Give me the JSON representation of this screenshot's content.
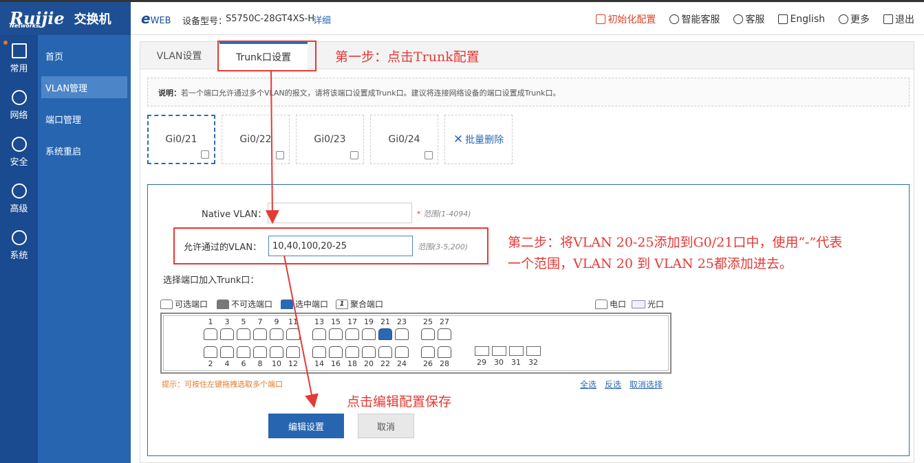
{
  "brand": {
    "logo": "Ruijie",
    "logo_sub": "Networks",
    "title": "交换机"
  },
  "header": {
    "eweb": "e",
    "eweb_suffix": "WEB",
    "model_label": "设备型号：",
    "model_value": "S5750C-28GT4XS-H",
    "detail": "详细",
    "actions": [
      "初始化配置",
      "智能客服",
      "客服",
      "English",
      "更多",
      "退出"
    ]
  },
  "nav": {
    "primary": [
      "常用",
      "网络",
      "安全",
      "高级",
      "系统"
    ],
    "secondary": [
      "首页",
      "VLAN管理",
      "端口管理",
      "系统重启"
    ]
  },
  "tabs": [
    "VLAN设置",
    "Trunk口设置"
  ],
  "note": {
    "label": "说明：",
    "text": "若一个端口允许通过多个VLAN的报文，请将该端口设置成Trunk口。建议将连接网络设备的端口设置成Trunk口。"
  },
  "port_cards": [
    "Gi0/21",
    "Gi0/22",
    "Gi0/23",
    "Gi0/24"
  ],
  "batch_delete": "批量删除",
  "form": {
    "native_vlan_label": "Native VLAN：",
    "native_vlan_value": "",
    "native_vlan_hint": "范围(1-4094)",
    "allowed_vlan_label": "允许通过的VLAN：",
    "allowed_vlan_value": "10,40,100,20-25",
    "allowed_vlan_hint": "范围(3-5,200)",
    "select_ports_label": "选择端口加入Trunk口："
  },
  "legend": {
    "available": "可选端口",
    "unavailable": "不可选端口",
    "selected": "选中端口",
    "aggregate": "聚合端口",
    "aggregate_num": "1",
    "electric": "电口",
    "fiber": "光口"
  },
  "ports": {
    "top": [
      "1",
      "3",
      "5",
      "7",
      "9",
      "11",
      "13",
      "15",
      "17",
      "19",
      "21",
      "23",
      "25",
      "27"
    ],
    "bottom": [
      "2",
      "4",
      "6",
      "8",
      "10",
      "12",
      "14",
      "16",
      "18",
      "20",
      "22",
      "24",
      "26",
      "28"
    ],
    "fiber": [
      "29",
      "30",
      "31",
      "32"
    ],
    "selected": "21"
  },
  "tip": "提示：可按住左键拖拽选取多个端口",
  "select_links": [
    "全选",
    "反选",
    "取消选择"
  ],
  "buttons": {
    "save": "编辑设置",
    "cancel": "取消"
  },
  "annotations": {
    "step1": "第一步：点击Trunk配置",
    "step2_line1": "第二步：将VLAN 20-25添加到G0/21口中，使用“-”代表",
    "step2_line2": "一个范围，VLAN 20 到 VLAN 25都添加进去。",
    "step3": "点击编辑配置保存"
  },
  "colors": {
    "primary": "#2765b0",
    "nav_dark": "#1a4a8f",
    "annotation_red": "#e53935",
    "tip_orange": "#e87722"
  }
}
